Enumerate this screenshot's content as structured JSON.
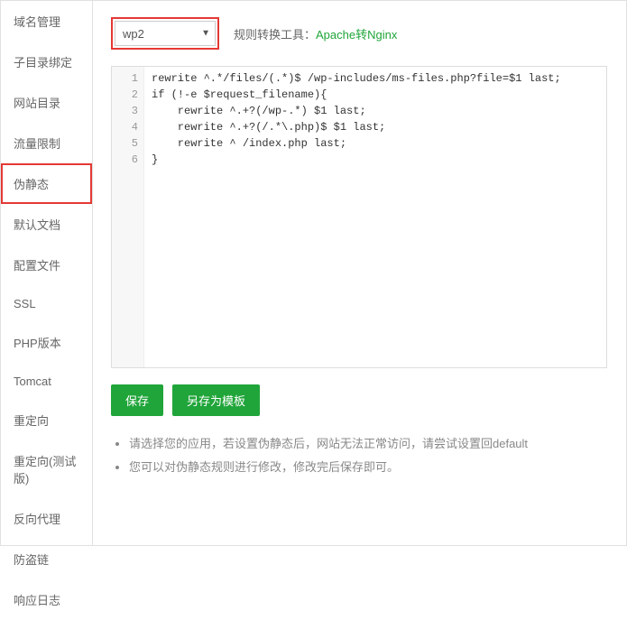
{
  "sidebar": {
    "items": [
      {
        "label": "域名管理"
      },
      {
        "label": "子目录绑定"
      },
      {
        "label": "网站目录"
      },
      {
        "label": "流量限制"
      },
      {
        "label": "伪静态"
      },
      {
        "label": "默认文档"
      },
      {
        "label": "配置文件"
      },
      {
        "label": "SSL"
      },
      {
        "label": "PHP版本"
      },
      {
        "label": "Tomcat"
      },
      {
        "label": "重定向"
      },
      {
        "label": "重定向(测试版)"
      },
      {
        "label": "反向代理"
      },
      {
        "label": "防盗链"
      },
      {
        "label": "响应日志"
      }
    ]
  },
  "top": {
    "select_value": "wp2",
    "tool_label": "规则转换工具：",
    "tool_link": "Apache转Nginx"
  },
  "editor": {
    "lines": [
      "1",
      "2",
      "3",
      "4",
      "5",
      "6"
    ],
    "code": "rewrite ^.*/files/(.*)$ /wp-includes/ms-files.php?file=$1 last;\nif (!-e $request_filename){\n    rewrite ^.+?(/wp-.*) $1 last;\n    rewrite ^.+?(/.*\\.php)$ $1 last;\n    rewrite ^ /index.php last;\n}"
  },
  "buttons": {
    "save": "保存",
    "save_as": "另存为模板"
  },
  "tips": {
    "line1": "请选择您的应用，若设置伪静态后，网站无法正常访问，请尝试设置回default",
    "line2": "您可以对伪静态规则进行修改，修改完后保存即可。"
  }
}
